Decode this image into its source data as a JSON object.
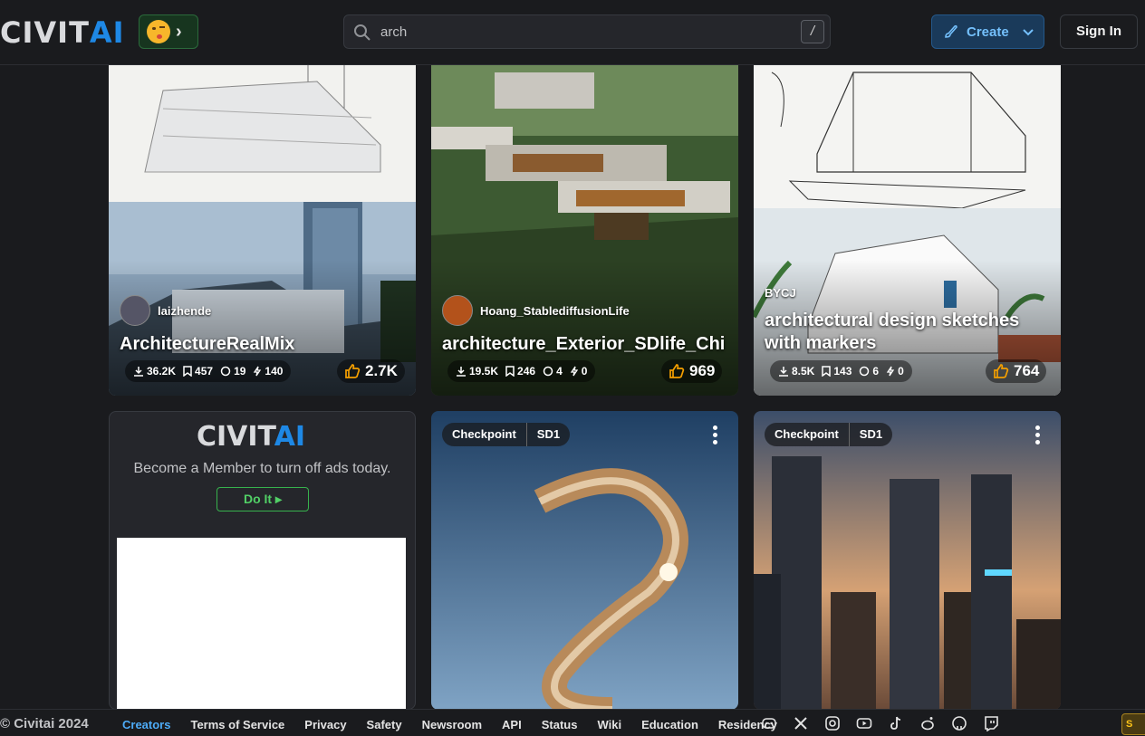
{
  "header": {
    "logo_part1": "CIVIT",
    "logo_part2": "AI",
    "search_value": "arch",
    "search_shortcut": "/",
    "create_label": "Create",
    "signin_label": "Sign In"
  },
  "cards": [
    {
      "creator": "laizhende",
      "title": "ArchitectureRealMix",
      "downloads": "36.2K",
      "bookmarks": "457",
      "comments": "19",
      "tips": "140",
      "likes": "2.7K"
    },
    {
      "creator": "Hoang_StablediffusionLife",
      "title": "architecture_Exterior_SDlife_Chi",
      "downloads": "19.5K",
      "bookmarks": "246",
      "comments": "4",
      "tips": "0",
      "likes": "969"
    },
    {
      "creator": "BYCJ",
      "title_line1": "architectural design sketches",
      "title_line2": "with markers",
      "downloads": "8.5K",
      "bookmarks": "143",
      "comments": "6",
      "tips": "0",
      "likes": "764"
    },
    {
      "type": "Checkpoint",
      "base": "SD1"
    },
    {
      "type": "Checkpoint",
      "base": "SD1"
    }
  ],
  "ad": {
    "logo_part1": "CIVIT",
    "logo_part2": "AI",
    "text": "Become a Member to turn off ads today.",
    "button": "Do It"
  },
  "footer": {
    "copyright": "© Civitai 2024",
    "links": [
      "Creators",
      "Terms of Service",
      "Privacy",
      "Safety",
      "Newsroom",
      "API",
      "Status",
      "Wiki",
      "Education",
      "Residency"
    ],
    "active_link": "Creators",
    "support": "S"
  }
}
